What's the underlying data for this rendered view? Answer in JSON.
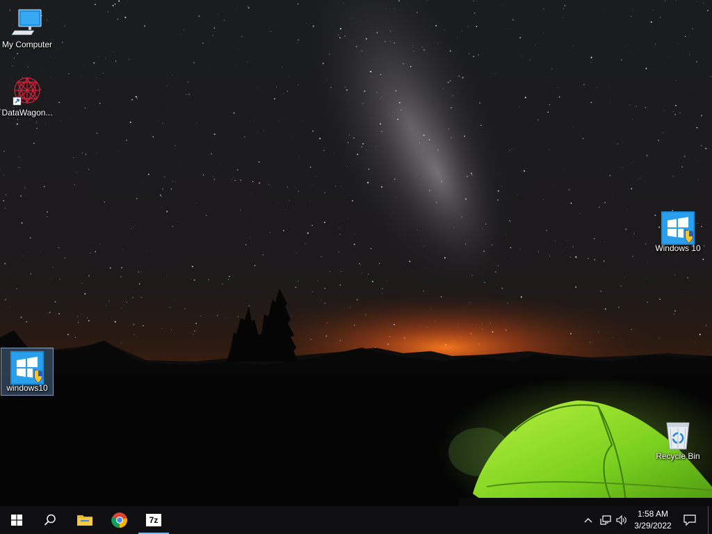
{
  "desktop": {
    "icons": [
      {
        "label": "My Computer",
        "icon": "computer-icon"
      },
      {
        "label": "DataWagon...",
        "icon": "datawagon-shortcut-icon"
      },
      {
        "label": "Windows 10",
        "icon": "windows10-installer-icon"
      },
      {
        "label": "windows10",
        "icon": "windows10-installer-icon",
        "selected": true
      },
      {
        "label": "Recycle Bin",
        "icon": "recycle-bin-icon"
      }
    ]
  },
  "taskbar": {
    "buttons": [
      {
        "name": "start-button",
        "icon": "windows-logo-icon"
      },
      {
        "name": "search-button",
        "icon": "search-icon"
      },
      {
        "name": "file-explorer-button",
        "icon": "folder-icon"
      },
      {
        "name": "chrome-button",
        "icon": "chrome-icon"
      },
      {
        "name": "7zip-button",
        "icon": "7zip-icon",
        "text": "7z",
        "active": true
      }
    ],
    "tray": {
      "icons": [
        "chevron-up-icon",
        "network-icon",
        "volume-icon"
      ],
      "time": "1:58 AM",
      "date": "3/29/2022"
    },
    "accent": "#76b9ed"
  }
}
